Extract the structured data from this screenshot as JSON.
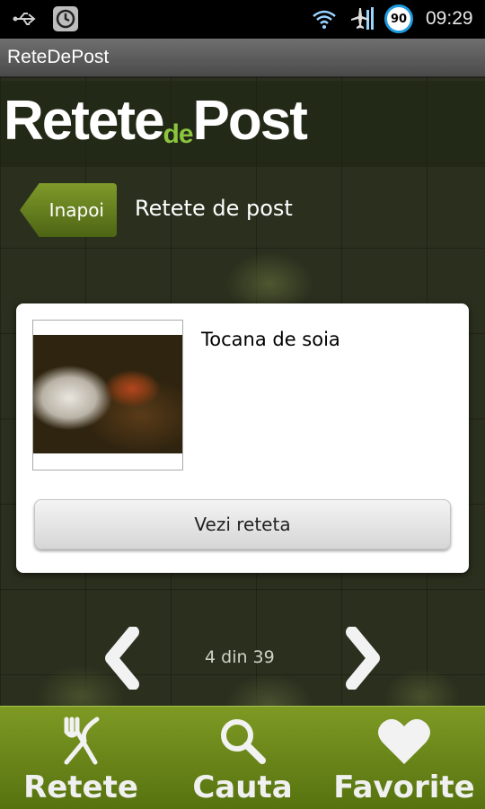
{
  "status": {
    "battery": "90",
    "time": "09:29"
  },
  "app_title": "ReteDePost",
  "logo": {
    "part1": "Retete",
    "part2": "de",
    "part3": "Post"
  },
  "back_label": "Inapoi",
  "section_title": "Retete de post",
  "card": {
    "recipe_name": "Tocana de soia",
    "button_label": "Vezi reteta"
  },
  "pager": {
    "text": "4 din 39"
  },
  "nav": {
    "retete": "Retete",
    "cauta": "Cauta",
    "favorite": "Favorite"
  },
  "colors": {
    "accent_green": "#6b8a1c",
    "battery_ring": "#1e9be0"
  }
}
